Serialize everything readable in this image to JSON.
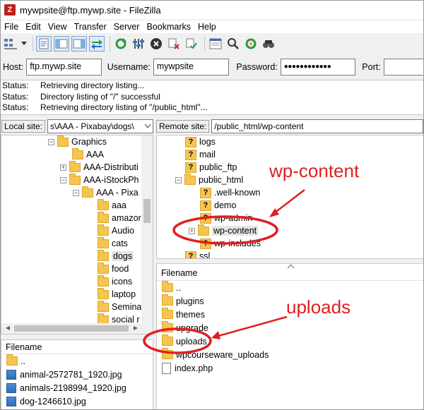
{
  "window": {
    "title": "mywpsite@ftp.mywp.site - FileZilla",
    "app_icon": "Z"
  },
  "menu": [
    "File",
    "Edit",
    "View",
    "Transfer",
    "Server",
    "Bookmarks",
    "Help"
  ],
  "toolbar": {
    "icons": [
      "site-manager-icon",
      "dropdown-arrow-icon",
      "message-log-icon",
      "local-tree-icon",
      "remote-tree-icon",
      "transfer-queue-icon",
      "refresh-icon",
      "filter-icon",
      "cancel-icon",
      "disconnect-icon",
      "reconnect-icon",
      "directory-compare-icon",
      "search-icon",
      "sync-browsing-icon",
      "find-files-icon"
    ]
  },
  "quickconnect": {
    "host_label": "Host:",
    "host_value": "ftp.mywp.site",
    "username_label": "Username:",
    "username_value": "mywpsite",
    "password_label": "Password:",
    "password_value": "●●●●●●●●●●●●",
    "port_label": "Port:",
    "port_value": ""
  },
  "log": [
    {
      "label": "Status:",
      "text": "Retrieving directory listing..."
    },
    {
      "label": "Status:",
      "text": "Directory listing of \"/\" successful"
    },
    {
      "label": "Status:",
      "text": "Retrieving directory listing of \"/public_html\"..."
    }
  ],
  "local": {
    "label": "Local site:",
    "path": "s\\AAA - Pixabay\\dogs\\",
    "tree": [
      "Graphics",
      "AAA",
      "AAA-Distributi",
      "AAA-iStockPh",
      "AAA - Pixa",
      "aaa",
      "amazor",
      "Audio",
      "cats",
      "dogs",
      "food",
      "icons",
      "laptop",
      "Semina",
      "social r"
    ],
    "list_header": "Filename",
    "files": [
      "..",
      "animal-2572781_1920.jpg",
      "animals-2198994_1920.jpg",
      "dog-1246610.jpg"
    ]
  },
  "remote": {
    "label": "Remote site:",
    "path": "/public_html/wp-content",
    "tree": [
      "logs",
      "mail",
      "public_ftp",
      "public_html",
      ".well-known",
      "demo",
      "wp-admin",
      "wp-content",
      "wp-includes",
      "ssl"
    ],
    "list_header": "Filename",
    "files": [
      "..",
      "plugins",
      "themes",
      "upgrade",
      "uploads",
      "wpcourseware_uploads",
      "index.php"
    ]
  },
  "annotations": {
    "wp_content_label": "wp-content",
    "uploads_label": "uploads",
    "color": "#e02020"
  }
}
